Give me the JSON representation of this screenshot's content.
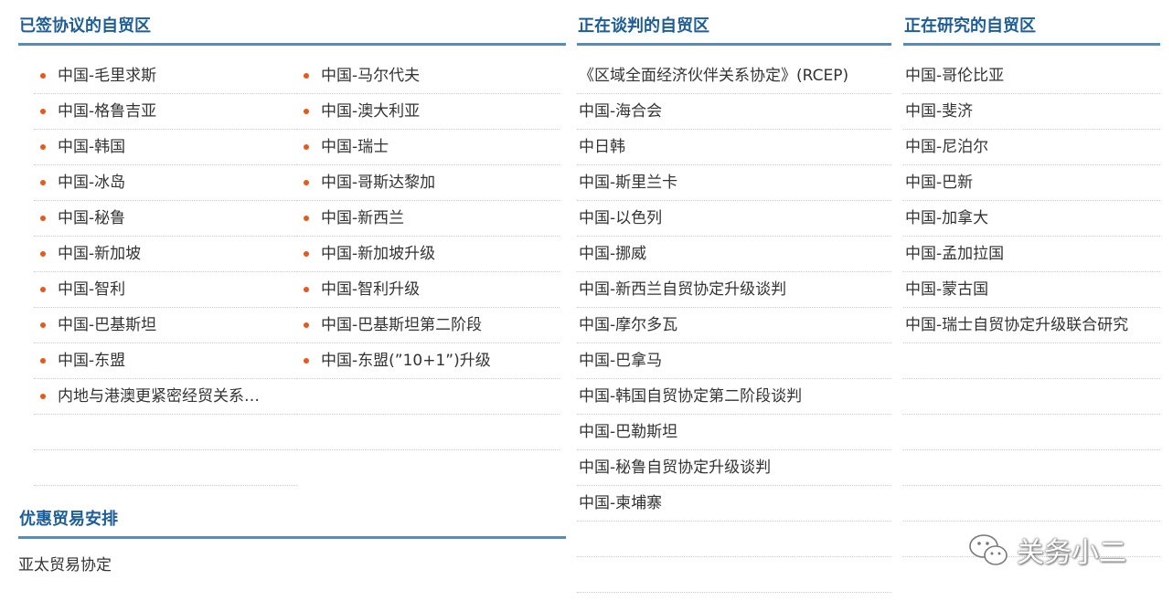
{
  "signed": {
    "title": "已签协议的自贸区",
    "left": [
      "中国-毛里求斯",
      "中国-格鲁吉亚",
      "中国-韩国",
      "中国-冰岛",
      "中国-秘鲁",
      "中国-新加坡",
      "中国-智利",
      "中国-巴基斯坦",
      "中国-东盟",
      "内地与港澳更紧密经贸关系…"
    ],
    "right": [
      "中国-马尔代夫",
      "中国-澳大利亚",
      "中国-瑞士",
      "中国-哥斯达黎加",
      "中国-新西兰",
      "中国-新加坡升级",
      "中国-智利升级",
      "中国-巴基斯坦第二阶段",
      "中国-东盟(”10+1”)升级"
    ]
  },
  "negotiating": {
    "title": "正在谈判的自贸区",
    "items": [
      "《区域全面经济伙伴关系协定》(RCEP)",
      "中国-海合会",
      "中日韩",
      "中国-斯里兰卡",
      "中国-以色列",
      "中国-挪威",
      "中国-新西兰自贸协定升级谈判",
      "中国-摩尔多瓦",
      "中国-巴拿马",
      "中国-韩国自贸协定第二阶段谈判",
      "中国-巴勒斯坦",
      "中国-秘鲁自贸协定升级谈判",
      "中国-柬埔寨"
    ]
  },
  "studying": {
    "title": "正在研究的自贸区",
    "items": [
      "中国-哥伦比亚",
      "中国-斐济",
      "中国-尼泊尔",
      "中国-巴新",
      "中国-加拿大",
      "中国-孟加拉国",
      "中国-蒙古国",
      "中国-瑞士自贸协定升级联合研究"
    ]
  },
  "preferential": {
    "title": "优惠贸易安排",
    "items": [
      "亚太贸易协定"
    ]
  },
  "watermark": {
    "text": "关务小二",
    "icon": "wechat-icon"
  },
  "colors": {
    "title": "#1f5d96",
    "rule": "#4a90c8",
    "bullet": "#e35a1b",
    "text": "#333333"
  }
}
